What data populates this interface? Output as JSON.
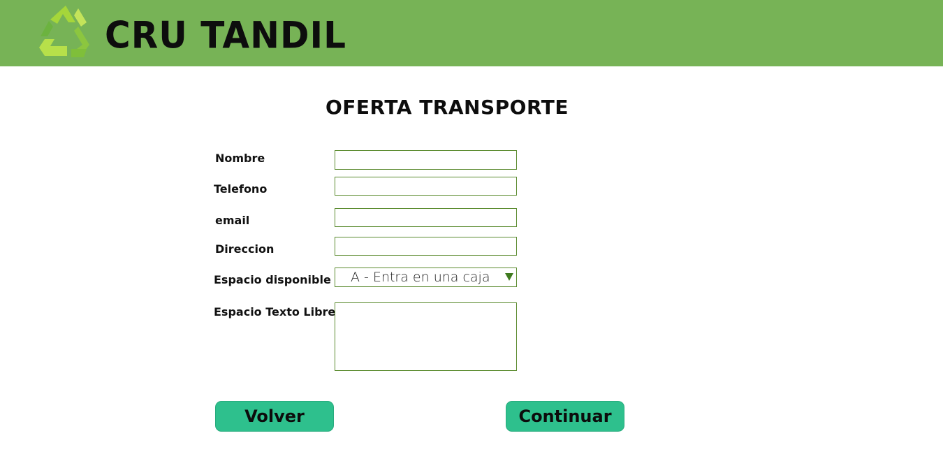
{
  "header": {
    "brand": "CRU TANDIL",
    "logo_icon": "recycle-icon",
    "background_color": "#77b356"
  },
  "form": {
    "title": "OFERTA TRANSPORTE",
    "fields": {
      "nombre": {
        "label": "Nombre",
        "value": ""
      },
      "telefono": {
        "label": "Telefono",
        "value": ""
      },
      "email": {
        "label": "email",
        "value": ""
      },
      "direccion": {
        "label": "Direccion",
        "value": ""
      },
      "espacio": {
        "label": "Espacio disponible",
        "selected": "A - Entra en una caja"
      },
      "texto_libre": {
        "label": "Espacio Texto Libre",
        "value": ""
      }
    },
    "border_color": "#5b8b2f"
  },
  "buttons": {
    "back_label": "Volver",
    "continue_label": "Continuar",
    "color": "#2ec08d"
  }
}
